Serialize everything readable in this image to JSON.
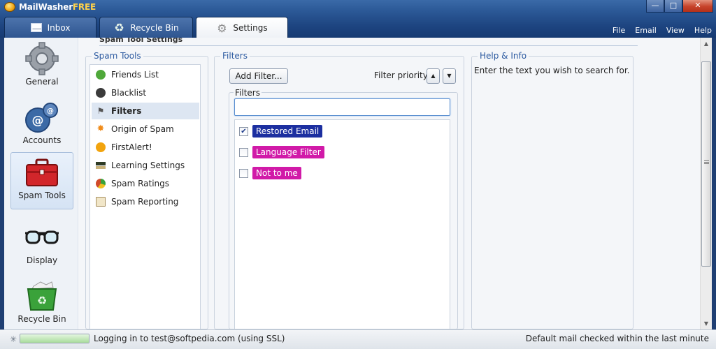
{
  "app": {
    "title_main": "MailWasher",
    "title_free": "FREE"
  },
  "window_controls": {
    "minimize": "—",
    "maximize": "□",
    "close": "✕"
  },
  "tabs": [
    {
      "label": "Inbox",
      "icon": "mail-icon"
    },
    {
      "label": "Recycle Bin",
      "icon": "recycle-icon"
    },
    {
      "label": "Settings",
      "icon": "gear-icon"
    }
  ],
  "menu": [
    "File",
    "Email",
    "View",
    "Help"
  ],
  "sidebar": {
    "items": [
      {
        "label": "General",
        "icon": "gear-icon"
      },
      {
        "label": "Accounts",
        "icon": "accounts-icon"
      },
      {
        "label": "Spam Tools",
        "icon": "toolbox-icon"
      },
      {
        "label": "Display",
        "icon": "glasses-icon"
      },
      {
        "label": "Recycle Bin",
        "icon": "recycle-bin-icon"
      }
    ]
  },
  "panel": {
    "header": "Spam Tool Settings"
  },
  "spam_tools": {
    "title": "Spam Tools",
    "items": [
      {
        "label": "Friends List",
        "icon": "friends-icon",
        "color": "#4fa83a"
      },
      {
        "label": "Blacklist",
        "icon": "blacklist-icon",
        "color": "#3b3b3b"
      },
      {
        "label": "Filters",
        "icon": "filter-icon",
        "color": "#6b6b6b",
        "selected": true
      },
      {
        "label": "Origin of Spam",
        "icon": "origin-icon",
        "color": "#f08b1a"
      },
      {
        "label": "FirstAlert!",
        "icon": "alert-icon",
        "color": "#f2a40e"
      },
      {
        "label": "Learning Settings",
        "icon": "grad-cap-icon",
        "color": "#2e3a24"
      },
      {
        "label": "Spam Ratings",
        "icon": "rating-icon",
        "color": "#d04a2a"
      },
      {
        "label": "Spam Reporting",
        "icon": "report-icon",
        "color": "#c9a85a"
      }
    ]
  },
  "filters": {
    "title": "Filters",
    "add_label": "Add Filter...",
    "priority_label": "Filter priority:",
    "priority_up": "▲",
    "priority_down": "▼",
    "box_title": "Filters",
    "search_value": "",
    "items": [
      {
        "label": "Restored Email",
        "checked": true,
        "color": "#1c2fa0"
      },
      {
        "label": "Language Filter",
        "checked": false,
        "color": "#d11aa8"
      },
      {
        "label": "Not to me",
        "checked": false,
        "color": "#d11aa8"
      }
    ]
  },
  "help": {
    "title": "Help & Info",
    "text": "Enter the text you wish to search for."
  },
  "scrollbar": {
    "up": "▲",
    "down": "▼"
  },
  "status": {
    "spinner": "✳",
    "progress": 1.0,
    "left_text": "Logging in to test@softpedia.com (using SSL)",
    "right_text": "Default mail checked within the last minute"
  }
}
